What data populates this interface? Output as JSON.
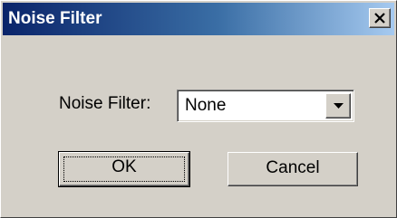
{
  "window": {
    "title": "Noise Filter",
    "colors": {
      "titlebar_start": "#0a246a",
      "titlebar_end": "#a6caf0",
      "face": "#d4d0c8"
    }
  },
  "title_bar": {
    "close_icon": "close-icon"
  },
  "form": {
    "noise_filter_label": "Noise Filter:",
    "noise_filter_value": "None",
    "dropdown_icon": "chevron-down-icon"
  },
  "buttons": {
    "ok_label": "OK",
    "cancel_label": "Cancel"
  }
}
